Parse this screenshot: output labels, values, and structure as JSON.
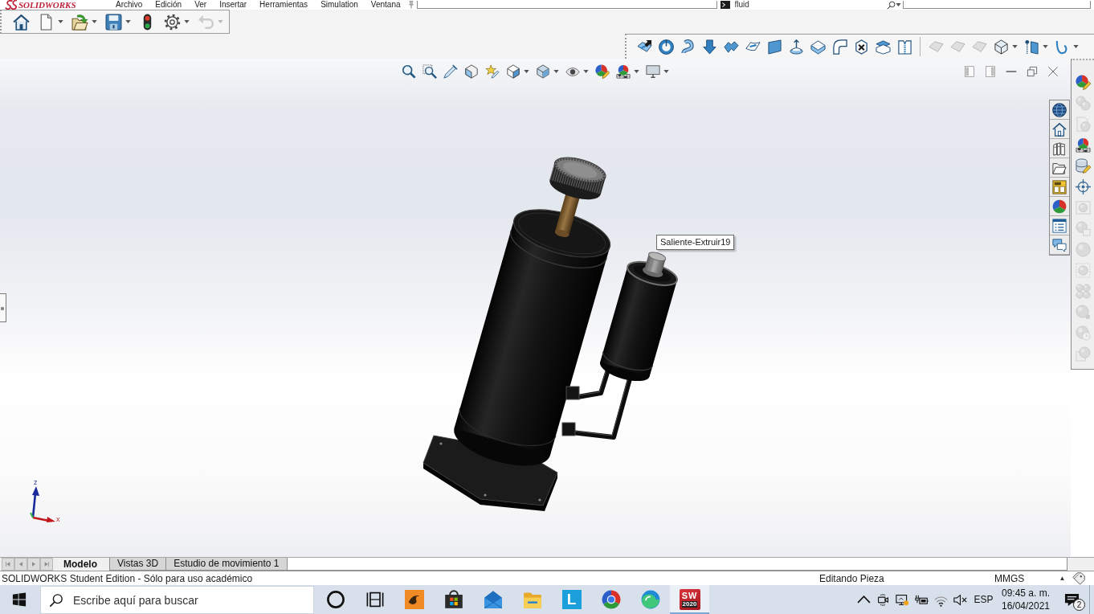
{
  "menu_bar": {
    "logo": "SOLIDWORKS",
    "items": [
      "Archivo",
      "Edición",
      "Ver",
      "Insertar",
      "Herramientas",
      "Simulation",
      "Ventana"
    ],
    "search_field": {
      "value": "fluid"
    }
  },
  "quick_access_toolbar": {
    "buttons": [
      {
        "kind": "home",
        "dropdown": false,
        "disabled": false
      },
      {
        "kind": "document",
        "dropdown": true,
        "disabled": false
      },
      {
        "kind": "folder-arrow",
        "dropdown": true,
        "disabled": false
      },
      {
        "kind": "floppy",
        "dropdown": true,
        "disabled": false
      },
      {
        "kind": "traffic-light",
        "dropdown": false,
        "disabled": false
      },
      {
        "kind": "gear",
        "dropdown": true,
        "disabled": false
      },
      {
        "kind": "undo",
        "dropdown": true,
        "disabled": true
      }
    ]
  },
  "command_toolbar": {
    "groups": [
      {
        "buttons": [
          {
            "kind": "sheet-arrow",
            "dropdown": false,
            "disabled": false
          },
          {
            "kind": "ring",
            "dropdown": false,
            "disabled": false
          },
          {
            "kind": "s-curve",
            "dropdown": false,
            "disabled": false
          },
          {
            "kind": "down-arrow",
            "dropdown": false,
            "disabled": false
          },
          {
            "kind": "wave-sheet",
            "dropdown": false,
            "disabled": false
          },
          {
            "kind": "twisted-sheet",
            "dropdown": false,
            "disabled": false
          },
          {
            "kind": "plane",
            "dropdown": false,
            "disabled": false
          },
          {
            "kind": "dome-arrow",
            "dropdown": false,
            "disabled": false
          },
          {
            "kind": "layered-sheet",
            "dropdown": false,
            "disabled": false
          },
          {
            "kind": "elbow",
            "dropdown": false,
            "disabled": false
          },
          {
            "kind": "crossed-cube",
            "dropdown": false,
            "disabled": false
          },
          {
            "kind": "stacked-sheets",
            "dropdown": false,
            "disabled": false
          },
          {
            "kind": "zipper-sheet",
            "dropdown": false,
            "disabled": false
          }
        ]
      },
      {
        "buttons": [
          {
            "kind": "sheet",
            "dropdown": false,
            "disabled": true
          },
          {
            "kind": "sheet",
            "dropdown": false,
            "disabled": true
          },
          {
            "kind": "sheet",
            "dropdown": false,
            "disabled": true
          },
          {
            "kind": "cube",
            "dropdown": true,
            "disabled": false
          },
          {
            "kind": "pin-plane",
            "dropdown": true,
            "disabled": false
          },
          {
            "kind": "u-curve",
            "dropdown": true,
            "disabled": false
          }
        ]
      }
    ]
  },
  "view_toolbar": {
    "buttons": [
      {
        "kind": "magnifier",
        "dropdown": false,
        "disabled": false
      },
      {
        "kind": "magnifier-frame",
        "dropdown": false,
        "disabled": false
      },
      {
        "kind": "pencil",
        "dropdown": false,
        "disabled": false
      },
      {
        "kind": "section-cube",
        "dropdown": false,
        "disabled": false
      },
      {
        "kind": "star-pencil",
        "dropdown": false,
        "disabled": false
      },
      {
        "kind": "view-cube",
        "dropdown": true,
        "disabled": false
      },
      {
        "kind": "display-cube",
        "dropdown": true,
        "disabled": false
      },
      {
        "kind": "eye",
        "dropdown": true,
        "disabled": false
      },
      {
        "kind": "color-ball-pencil",
        "dropdown": false,
        "disabled": false
      },
      {
        "kind": "color-ball-scene",
        "dropdown": true,
        "disabled": false
      },
      {
        "kind": "monitor",
        "dropdown": true,
        "disabled": false
      }
    ]
  },
  "side_toolbar": {
    "buttons": [
      {
        "kind": "color-ball-pencil",
        "disabled": false
      },
      {
        "kind": "two-balls",
        "disabled": true
      },
      {
        "kind": "document-ball",
        "disabled": true
      },
      {
        "kind": "color-ball-scene",
        "disabled": false
      },
      {
        "kind": "cylinder-pencil",
        "disabled": false
      },
      {
        "kind": "crosshair",
        "disabled": false
      },
      {
        "kind": "framed-ball",
        "disabled": true
      },
      {
        "kind": "ball-window",
        "disabled": true
      },
      {
        "kind": "ball",
        "disabled": true
      },
      {
        "kind": "dashed-frame-ball",
        "disabled": true
      },
      {
        "kind": "four-balls",
        "disabled": true
      },
      {
        "kind": "ball-dot",
        "disabled": true
      },
      {
        "kind": "ball-clock",
        "disabled": true
      },
      {
        "kind": "ball-document",
        "disabled": true
      }
    ]
  },
  "viewport": {
    "tooltip": "Saliente-Extruir19",
    "triad": {
      "z_label": "z",
      "x_label": "x"
    }
  },
  "bottom_tabs": [
    {
      "label": "Modelo",
      "selected": true
    },
    {
      "label": "Vistas 3D",
      "selected": false
    },
    {
      "label": "Estudio de movimiento 1",
      "selected": false
    }
  ],
  "status_bar": {
    "message": "SOLIDWORKS Student Edition - Sólo para uso académico",
    "mode": "Editando Pieza",
    "units": "MMGS",
    "units_arrow": "▲"
  },
  "taskbar": {
    "search": {
      "placeholder": "Escribe aquí para buscar"
    },
    "apps": [
      {
        "kind": "ring",
        "active": false
      },
      {
        "kind": "task-view",
        "active": false
      },
      {
        "kind": "hand-tile",
        "active": false
      },
      {
        "kind": "bag",
        "active": false
      },
      {
        "kind": "envelope",
        "active": false
      },
      {
        "kind": "folder",
        "active": false
      },
      {
        "kind": "letter-tile",
        "text": "L",
        "active": false
      },
      {
        "kind": "tricolor-circle",
        "active": false
      },
      {
        "kind": "swirl-circle",
        "active": false
      },
      {
        "kind": "logo-tile",
        "text": "SW",
        "subtext": "2020",
        "active": true
      }
    ],
    "tray": {
      "language": "ESP",
      "time": "09:45 a. m.",
      "date": "16/04/2021",
      "notifications": "2"
    }
  }
}
